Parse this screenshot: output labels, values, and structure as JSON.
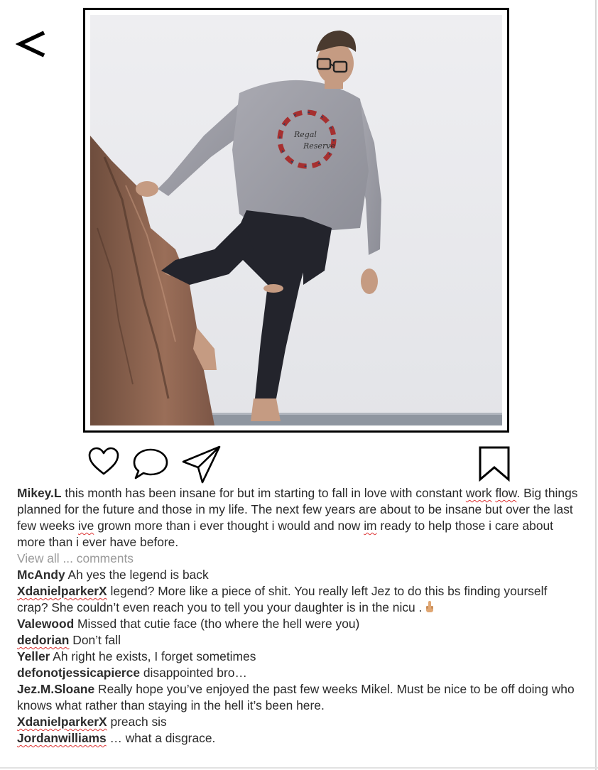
{
  "navigation": {
    "back_glyph": "<",
    "back_icon": "chevron-left-icon"
  },
  "photo": {
    "sweater_print_line1": "Regal",
    "sweater_print_line2": "Reserve"
  },
  "actions": {
    "like_icon": "heart-icon",
    "comment_icon": "comment-bubble-icon",
    "share_icon": "paper-plane-icon",
    "save_icon": "bookmark-icon"
  },
  "caption": {
    "username": "Mikey.L",
    "text_part1": " this month has been insane for but im starting to fall in love with constant ",
    "word_work": "work",
    "text_break": " ",
    "word_flow": "flow",
    "text_part2": ". Big things planned for the future and those in my life. The next few years are about to be insane but over the last few weeks ",
    "word_ive": "ive",
    "text_part3": " grown more than i ever thought i would and now ",
    "word_im": "im",
    "text_part4": " ready to help those i care about more than i ever have before."
  },
  "view_all_comments": "View all ... comments",
  "comments": [
    {
      "username": "McAndy",
      "text": " Ah yes the legend is back"
    },
    {
      "username": "XdanielparkerX",
      "text": " legend? More like a piece of shit. You really left Jez to do this bs finding yourself crap? She couldn’t even reach you to tell you your daughter is in the nicu .",
      "emoji": "middle-finger-emoji"
    },
    {
      "username": "Valewood",
      "text": " Missed that cutie face (tho where the hell were you)"
    },
    {
      "username": "dedorian",
      "text": " Don’t fall"
    },
    {
      "username": "Yeller",
      "text": " Ah right he exists, I forget sometimes"
    },
    {
      "username": "defonotjessicapierce",
      "text": " disappointed bro…"
    },
    {
      "username": "Jez.M.Sloane",
      "text": " Really hope you’ve enjoyed the past few weeks Mikel. Must be nice to be off doing who knows what rather than staying in the hell it’s been here."
    },
    {
      "username": "XdanielparkerX",
      "text": " preach sis"
    },
    {
      "username": "Jordanwilliams",
      "text": " … what a disgrace."
    }
  ]
}
